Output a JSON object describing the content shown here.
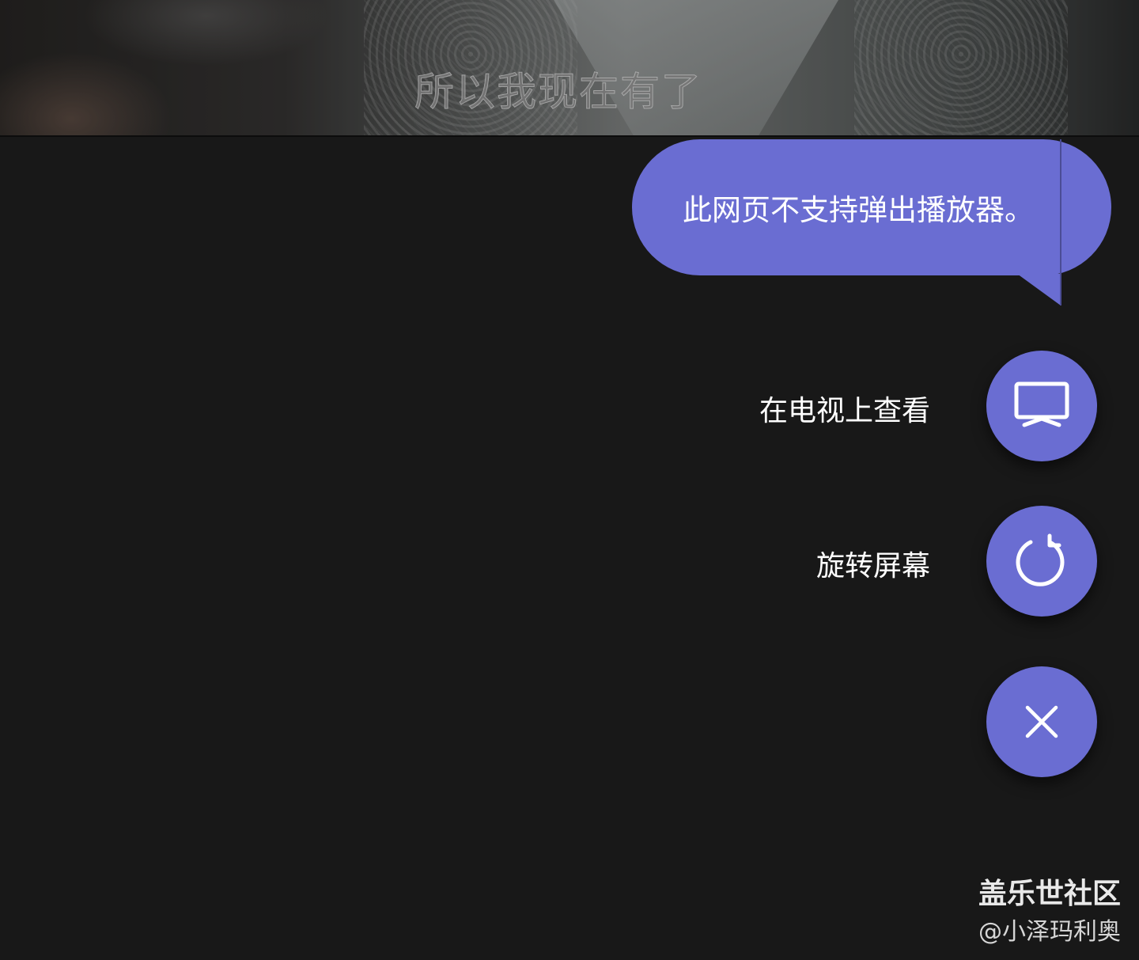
{
  "video": {
    "subtitle": "所以我现在有了"
  },
  "tooltip": {
    "message": "此网页不支持弹出播放器。"
  },
  "menu": {
    "items": [
      {
        "label": "在电视上查看",
        "icon": "tv-icon"
      },
      {
        "label": "旋转屏幕",
        "icon": "rotate-icon"
      }
    ],
    "close_icon": "close-icon",
    "accent_color": "#6a6dd2"
  },
  "watermark": {
    "site": "盖乐世社区",
    "user": "@小泽玛利奥"
  }
}
